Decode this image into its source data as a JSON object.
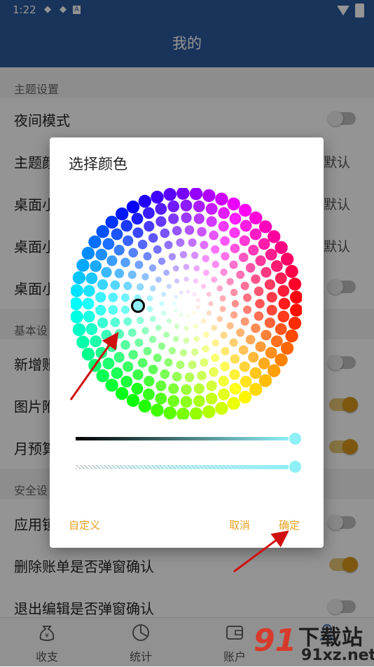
{
  "status_bar": {
    "time": "1:22",
    "icons": [
      "sync-icon",
      "sync-icon",
      "notification-a-icon"
    ],
    "right_icons": [
      "wifi-icon",
      "battery-charging-icon"
    ]
  },
  "app_bar": {
    "title": "我的"
  },
  "settings": {
    "section1": "主题设置",
    "night_mode": "夜间模式",
    "theme_color": "主题颜",
    "theme_color_value": "默认",
    "desktop1": "桌面小",
    "desktop1_value": "默认",
    "desktop2": "桌面小",
    "desktop2_value": "默认",
    "desktop3": "桌面小",
    "section2": "基本设",
    "new_bill": "新增账",
    "image": "图片附",
    "monthly": "月预算",
    "section3": "安全设",
    "app_lock": "应用锁",
    "delete_confirm": "删除账单是否弹窗确认",
    "exit_confirm": "退出编辑是否弹窗确认"
  },
  "toggles": {
    "night_mode": false,
    "desktop3": false,
    "new_bill": false,
    "image": true,
    "monthly": true,
    "app_lock": false,
    "delete_confirm": true,
    "exit_confirm": false
  },
  "bottom_nav": [
    {
      "label": "收支",
      "icon": "money-bag-icon"
    },
    {
      "label": "统计",
      "icon": "pie-chart-icon"
    },
    {
      "label": "账户",
      "icon": "wallet-icon"
    },
    {
      "label": "",
      "icon": "user-icon"
    }
  ],
  "dialog": {
    "title": "选择颜色",
    "custom": "自定义",
    "cancel": "取消",
    "confirm": "确定",
    "selected_color": "#8eeff6",
    "brightness_level": 1.0,
    "alpha_level": 1.0
  },
  "watermark": {
    "big": "91",
    "top": "下载站",
    "bottom": "91xz.net"
  }
}
